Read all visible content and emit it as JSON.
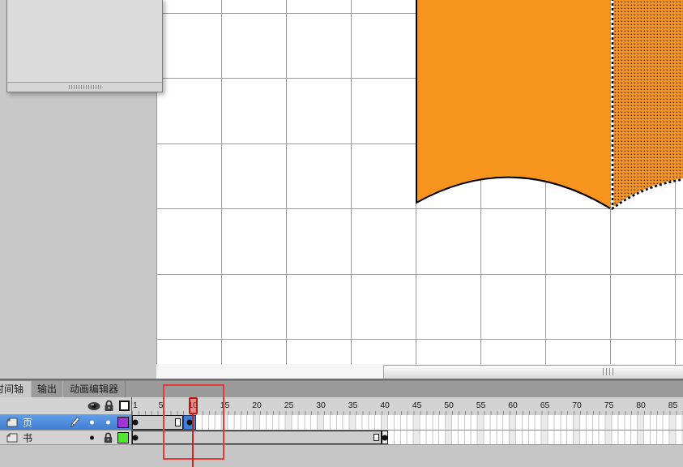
{
  "stage": {
    "grid_color": "#9a9a9a",
    "page_fill_color": "#f7941d",
    "selection_dot_color": "#2b2f63",
    "shapes": [
      "book-left-page-solid",
      "book-right-page-selected-hatched"
    ]
  },
  "floating_panel": {
    "grip_icon": "drag-grip"
  },
  "scrollbar": {
    "grip_icon": "|||"
  },
  "timeline": {
    "tabs": [
      {
        "label": "时间轴",
        "active": true
      },
      {
        "label": "输出",
        "active": false
      },
      {
        "label": "动画编辑器",
        "active": false
      }
    ],
    "header_icons": [
      "eye-icon",
      "lock-icon",
      "outline-square-icon"
    ],
    "ruler": {
      "frame_width": 7.9,
      "labels": [
        1,
        5,
        10,
        15,
        20,
        25,
        30,
        35,
        40,
        45,
        50,
        55,
        60,
        65,
        70,
        75,
        80,
        85
      ]
    },
    "playhead_frame": 10,
    "layers": [
      {
        "name": "页",
        "selected": true,
        "editing_pencil": true,
        "visible_dot": "#ffffff",
        "lock_state": "dot",
        "lock_dot": "#ffffff",
        "color": "#a335d8",
        "frames": {
          "span_start": 1,
          "span_end": 8,
          "keyframes": [
            1
          ],
          "end_marker": true,
          "selection": {
            "start": 9,
            "end": 10,
            "keyframe": true
          }
        }
      },
      {
        "name": "书",
        "selected": false,
        "editing_pencil": false,
        "visible_dot": "#111111",
        "lock_state": "locked",
        "color": "#54e632",
        "frames": {
          "span_start": 1,
          "span_end": 39,
          "keyframes": [
            1
          ],
          "end_marker": true,
          "isolated_keyframe": 40
        }
      }
    ]
  },
  "annotation": {
    "color": "#e23b3b",
    "highlighted_frame": 10
  }
}
